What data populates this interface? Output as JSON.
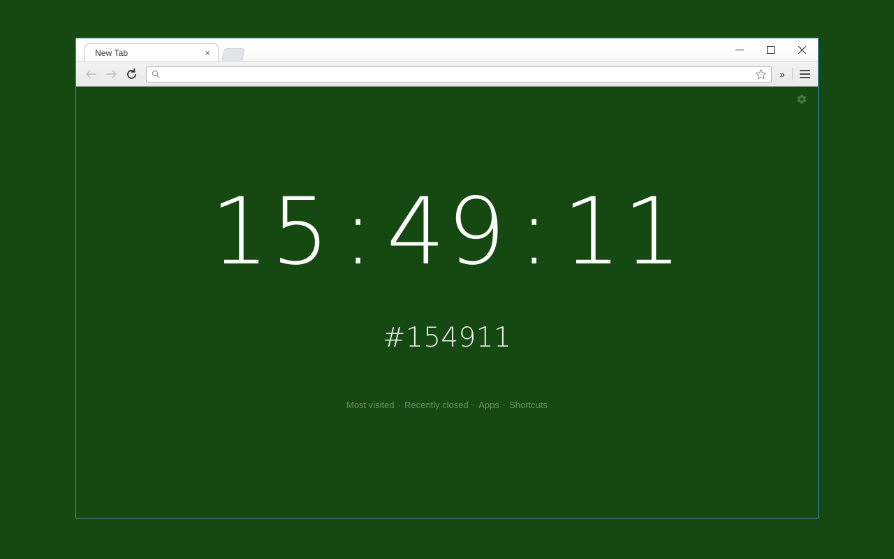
{
  "desktop": {
    "background_color": "#154911"
  },
  "window": {
    "border_color": "#3f93c9",
    "controls": {
      "minimize_label": "Minimize",
      "maximize_label": "Maximize",
      "close_label": "Close"
    }
  },
  "tabstrip": {
    "tabs": [
      {
        "title": "New Tab",
        "close_label": "×"
      }
    ],
    "new_tab_label": "New tab"
  },
  "toolbar": {
    "back_label": "Back",
    "forward_label": "Forward",
    "reload_label": "Reload",
    "omnibox": {
      "value": "",
      "placeholder": "",
      "search_icon": "search-icon",
      "bookmark_icon": "star-icon"
    },
    "overflow_label": "»",
    "menu_label": "Customize and control"
  },
  "page": {
    "background_color": "#154911",
    "settings_icon": "gear-icon",
    "clock": {
      "hours": "15",
      "minutes": "49",
      "seconds": "11",
      "separator": ":",
      "color": "#ffffff"
    },
    "hexcode": "#154911",
    "links": [
      {
        "label": "Most visited"
      },
      {
        "label": "Recently closed"
      },
      {
        "label": "Apps"
      },
      {
        "label": "Shortcuts"
      }
    ],
    "link_separator": "·",
    "link_color": "#6d8a64"
  }
}
